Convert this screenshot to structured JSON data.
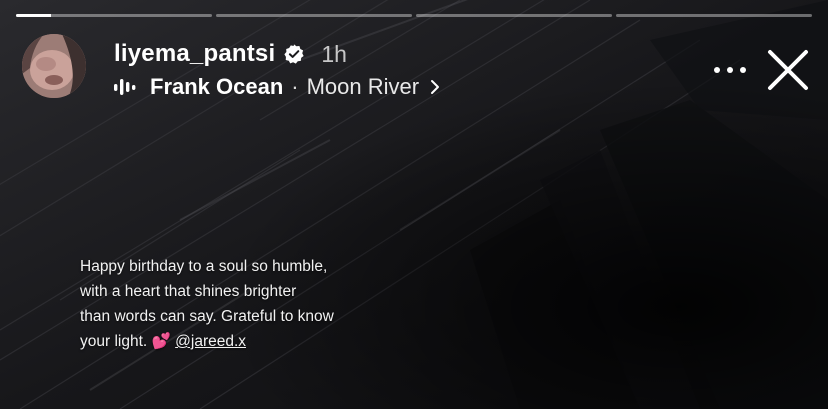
{
  "story": {
    "progress_segments": [
      {
        "filled": 0.18
      },
      {
        "filled": 0
      },
      {
        "filled": 0
      },
      {
        "filled": 0
      }
    ]
  },
  "header": {
    "avatar_icon": "profile-photo",
    "username": "liyema_pantsi",
    "verified_icon": "verified-badge-icon",
    "time_ago": "1h",
    "music": {
      "icon": "audio-bars-icon",
      "artist": "Frank Ocean",
      "separator": "·",
      "song": "Moon River",
      "chevron": "›"
    },
    "more_icon": "more-dots-icon",
    "close_icon": "close-icon"
  },
  "caption": {
    "line1": "Happy birthday to a soul so humble,",
    "line2": "with a heart that shines brighter",
    "line3": "than words can say. Grateful to know",
    "line4_text": "your light.",
    "line4_emoji": "💕",
    "mention": "@jareed.x"
  },
  "colors": {
    "background": "#0b0b0c",
    "text": "#ffffff",
    "heart": "#ff4fa0"
  }
}
